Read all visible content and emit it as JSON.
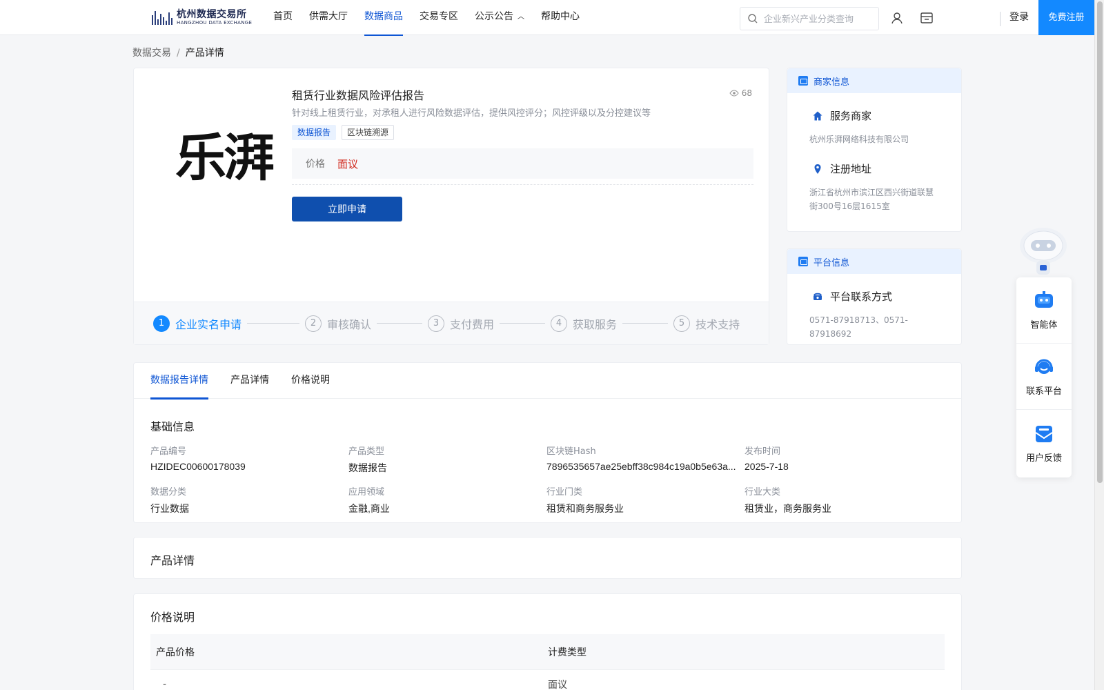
{
  "header": {
    "logo_cn": "杭州数据交易所",
    "logo_en": "HANGZHOU DATA EXCHANGE",
    "nav": [
      {
        "label": "首页",
        "active": false
      },
      {
        "label": "供需大厅",
        "active": false
      },
      {
        "label": "数据商品",
        "active": true
      },
      {
        "label": "交易专区",
        "active": false
      },
      {
        "label": "公示公告",
        "active": false,
        "has_caret": true
      },
      {
        "label": "帮助中心",
        "active": false
      }
    ],
    "search_placeholder": "企业新兴产业分类查询",
    "login": "登录",
    "register": "免费注册"
  },
  "breadcrumb": {
    "root": "数据交易",
    "separator": "/",
    "current": "产品详情"
  },
  "product": {
    "brand_logo": "乐湃",
    "title": "租赁行业数据风险评估报告",
    "views": "68",
    "description": "针对线上租赁行业，对承租人进行风险数据评估，提供风控评分；风控评级以及分控建议等",
    "tags": [
      "数据报告",
      "区块链溯源"
    ],
    "price_label": "价格",
    "price_value": "面议",
    "apply_button": "立即申请",
    "steps": [
      {
        "num": "1",
        "label": "企业实名申请",
        "active": true
      },
      {
        "num": "2",
        "label": "审核确认",
        "active": false
      },
      {
        "num": "3",
        "label": "支付费用",
        "active": false
      },
      {
        "num": "4",
        "label": "获取服务",
        "active": false
      },
      {
        "num": "5",
        "label": "技术支持",
        "active": false
      }
    ]
  },
  "merchant": {
    "head": "商家信息",
    "service_label": "服务商家",
    "service_value": "杭州乐湃网络科技有限公司",
    "address_label": "注册地址",
    "address_value": "浙江省杭州市滨江区西兴街道联慧街300号16层1615室"
  },
  "platform": {
    "head": "平台信息",
    "contact_label": "平台联系方式",
    "contact_value": "0571-87918713、0571-87918692"
  },
  "float": {
    "items": [
      "智能体",
      "联系平台",
      "用户反馈"
    ]
  },
  "tabs": [
    "数据报告详情",
    "产品详情",
    "价格说明"
  ],
  "basic": {
    "title": "基础信息",
    "fields": [
      {
        "k": "产品编号",
        "v": "HZIDEC00600178039"
      },
      {
        "k": "产品类型",
        "v": "数据报告"
      },
      {
        "k": "区块链Hash",
        "v": "7896535657ae25ebff38c984c19a0b5e63a..."
      },
      {
        "k": "发布时间",
        "v": "2025-7-18"
      },
      {
        "k": "数据分类",
        "v": "行业数据"
      },
      {
        "k": "应用领域",
        "v": "金融,商业"
      },
      {
        "k": "行业门类",
        "v": "租赁和商务服务业"
      },
      {
        "k": "行业大类",
        "v": "租赁业，商务服务业"
      }
    ]
  },
  "detail_section": {
    "title": "产品详情"
  },
  "price_section": {
    "title": "价格说明",
    "columns": [
      "产品价格",
      "计费类型"
    ],
    "rows": [
      [
        "-",
        "面议"
      ]
    ]
  },
  "colors": {
    "primary": "#0f56d4",
    "register_bg": "#1389ff",
    "price_red": "#d0261a",
    "apply_bg": "#0f4fae"
  }
}
